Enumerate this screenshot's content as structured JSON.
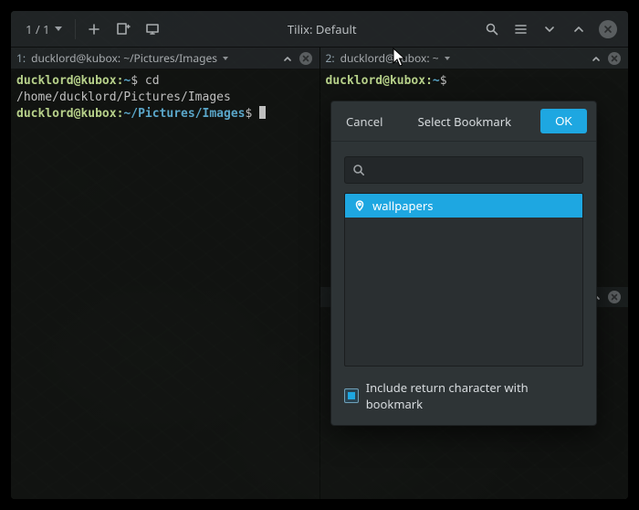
{
  "header": {
    "session_counter": "1 / 1",
    "title": "Tilix: Default"
  },
  "panes": {
    "left": {
      "index": "1:",
      "title": "ducklord@kubox: ~/Pictures/Images",
      "prompt1": {
        "user": "ducklord",
        "at": "@",
        "host": "kubox",
        "colon": ":",
        "path": "~",
        "dollar": "$"
      },
      "cmd1": "cd /home/ducklord/Pictures/Images",
      "prompt2": {
        "user": "ducklord",
        "at": "@",
        "host": "kubox",
        "colon": ":",
        "path": "~/Pictures/Images",
        "dollar": "$"
      }
    },
    "right": {
      "index": "2:",
      "title": "ducklord@kubox: ~",
      "prompt1": {
        "user": "ducklord",
        "at": "@",
        "host": "kubox",
        "colon": ":",
        "path": "~",
        "dollar": "$"
      }
    }
  },
  "dialog": {
    "cancel": "Cancel",
    "title": "Select Bookmark",
    "ok": "OK",
    "search_placeholder": "",
    "items": [
      {
        "label": "wallpapers",
        "selected": true
      }
    ],
    "checkbox_label": "Include return character with bookmark",
    "checkbox_checked": true
  }
}
